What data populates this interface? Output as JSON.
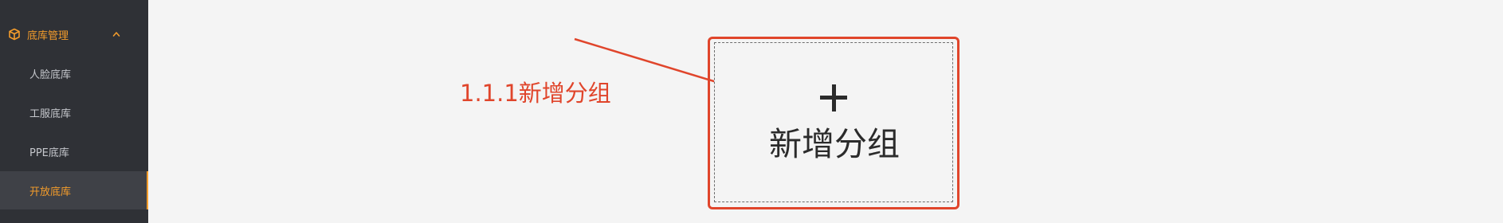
{
  "sidebar": {
    "menu": {
      "label": "底库管理",
      "icon": "cube-icon",
      "expanded": true,
      "accent_color": "#f39c2b"
    },
    "items": [
      {
        "label": "人脸底库",
        "active": false
      },
      {
        "label": "工服底库",
        "active": false
      },
      {
        "label": "PPE底库",
        "active": false
      },
      {
        "label": "开放底库",
        "active": true
      }
    ]
  },
  "annotation": {
    "text": "1.1.1新增分组",
    "color": "#e0452b"
  },
  "main": {
    "add_group": {
      "label": "新增分组",
      "icon": "plus-icon"
    }
  }
}
